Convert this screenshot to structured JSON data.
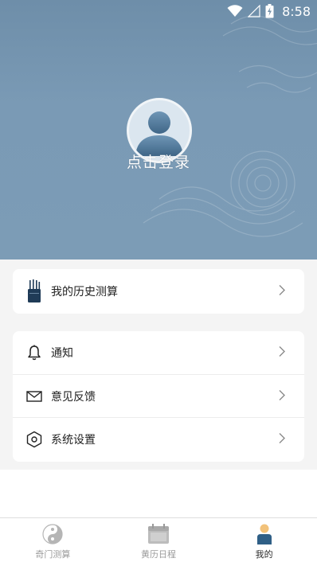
{
  "status_bar": {
    "time": "8:58"
  },
  "profile": {
    "login_label": "点击登录"
  },
  "history": {
    "label": "我的历史测算"
  },
  "menu": {
    "items": [
      {
        "label": "通知",
        "icon": "bell-icon"
      },
      {
        "label": "意见反馈",
        "icon": "mail-icon"
      },
      {
        "label": "系统设置",
        "icon": "settings-icon"
      }
    ]
  },
  "bottom_nav": {
    "items": [
      {
        "label": "奇门测算",
        "icon": "yin-yang-icon",
        "active": false
      },
      {
        "label": "黄历日程",
        "icon": "calendar-icon",
        "active": false
      },
      {
        "label": "我的",
        "icon": "user-icon",
        "active": true
      }
    ]
  },
  "colors": {
    "header": "#7a9ab5",
    "background": "#f4f4f4",
    "card": "#ffffff",
    "active_nav": "#2b2b2b",
    "inactive_nav": "#9a9a9a"
  }
}
